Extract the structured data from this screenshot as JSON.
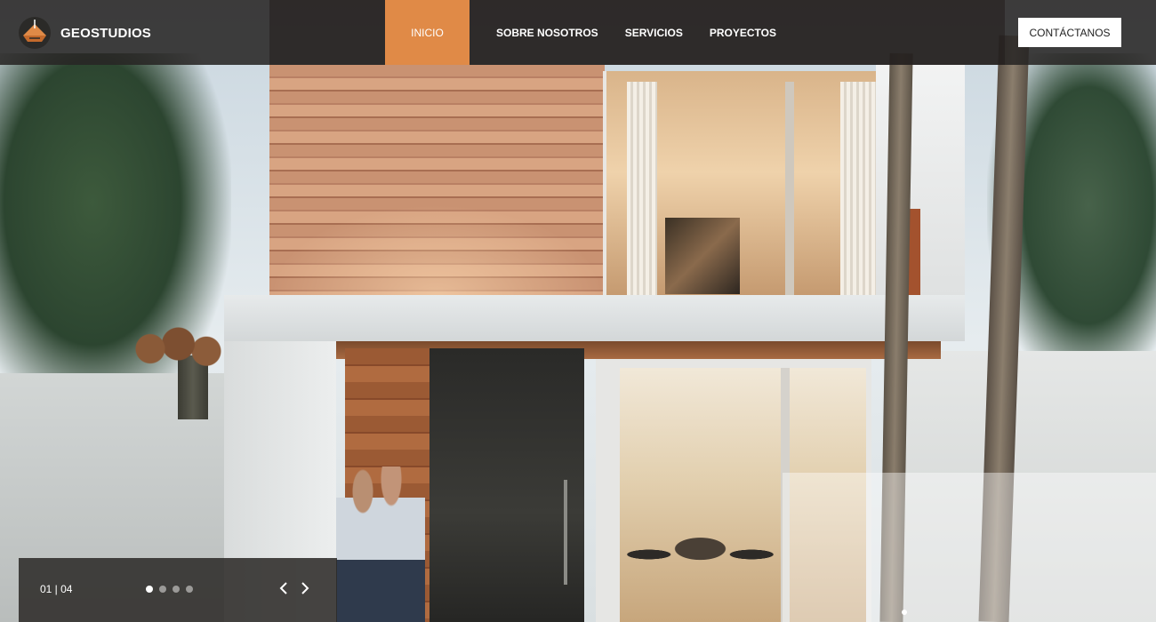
{
  "brand": {
    "name": "GEOSTUDIOS",
    "logo_icon": "pyramid-logo-icon"
  },
  "nav": {
    "items": [
      {
        "label": "INICIO",
        "active": true
      },
      {
        "label": "SOBRE NOSOTROS",
        "active": false
      },
      {
        "label": "SERVICIOS",
        "active": false
      },
      {
        "label": "PROYECTOS",
        "active": false
      }
    ],
    "contact_label": "CONTÁCTANOS"
  },
  "slider": {
    "counter": "01 | 04",
    "current": 1,
    "total": 4,
    "prev_icon": "chevron-left-icon",
    "next_icon": "chevron-right-icon"
  },
  "colors": {
    "accent": "#e08a47",
    "header_bg": "#28262480",
    "text_light": "#ffffff"
  }
}
